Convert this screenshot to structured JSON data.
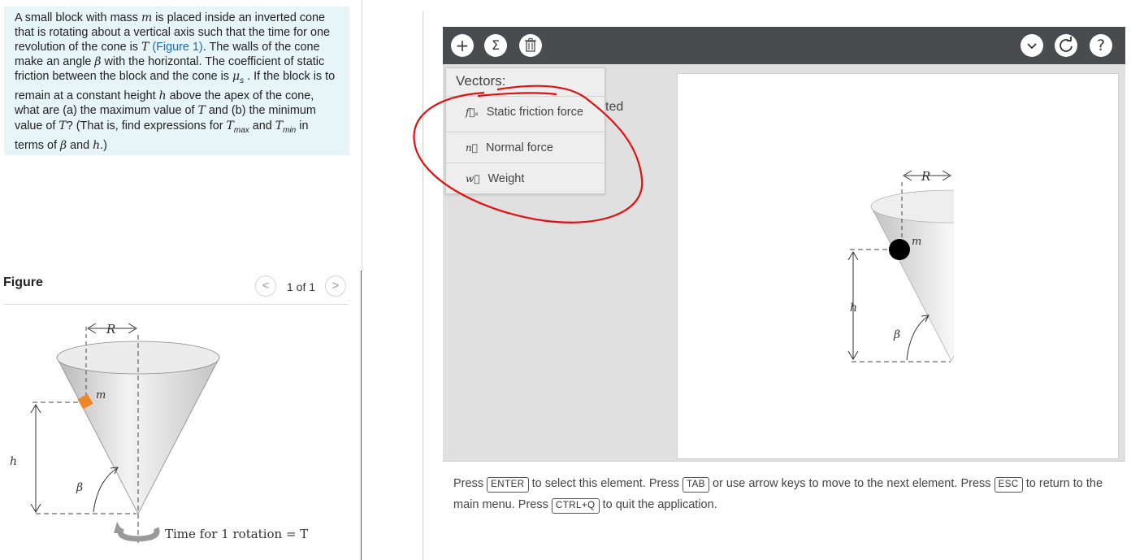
{
  "problem": {
    "t1": "A small block with mass ",
    "m": "m",
    "t2": " is placed inside an inverted cone that is rotating about a vertical axis such that the time for one revolution of the cone is ",
    "T": "T",
    "link": "(Figure 1)",
    "t3": ". The walls of the cone make an angle ",
    "beta": "β",
    "t4": " with the horizontal. The coefficient of static friction between the block and the cone is ",
    "mu": "μ",
    "mu_sub": "s",
    "t5": " . If the block is to remain at a constant height ",
    "h": "h",
    "t6": " above the apex of the cone, what are (a) the maximum value of ",
    "t7": " and (b) the minimum value of ",
    "t8": "? (That is, find expressions for ",
    "tmax_sub": "max",
    "t9": " and ",
    "tmin_sub": "min",
    "t10": " in terms of ",
    "t11": " and ",
    "t12": ".)"
  },
  "figure": {
    "title": "Figure",
    "pager": "1 of 1",
    "prev": "<",
    "next": ">",
    "label_R": "R",
    "label_m": "m",
    "label_h": "h",
    "label_beta": "β",
    "caption": "Time for 1 rotation = T"
  },
  "toolbar": {
    "add": "+",
    "sum": "Σ",
    "delete_icon": "trash-icon",
    "chevron": "⌄",
    "reset_icon": "reset-icon",
    "help": "?"
  },
  "menu": {
    "title": "Vectors:",
    "items": [
      {
        "symbol": "f⃗ₛ",
        "label": "Static friction force"
      },
      {
        "symbol": "n⃗",
        "label": "Normal force"
      },
      {
        "symbol": "w⃗",
        "label": "Weight"
      }
    ]
  },
  "behind_text": "ted",
  "canvas": {
    "label_R": "R",
    "label_m": "m",
    "label_h": "h",
    "label_beta": "β"
  },
  "instructions": {
    "p1": "Press ",
    "k1": "ENTER",
    "p2": " to select this element. Press ",
    "k2": "TAB",
    "p3": " or use arrow keys to move to the next element. Press ",
    "k3": "ESC",
    "p4": " to return to the main menu. Press ",
    "k4": "CTRL+Q",
    "p5": " to quit the application."
  },
  "colors": {
    "problem_bg": "#e8f5f8",
    "toolbar_bg": "#4a4b4e",
    "block_orange": "#f0862a",
    "annotation_red": "#e01010",
    "link": "#1a6bb8"
  }
}
